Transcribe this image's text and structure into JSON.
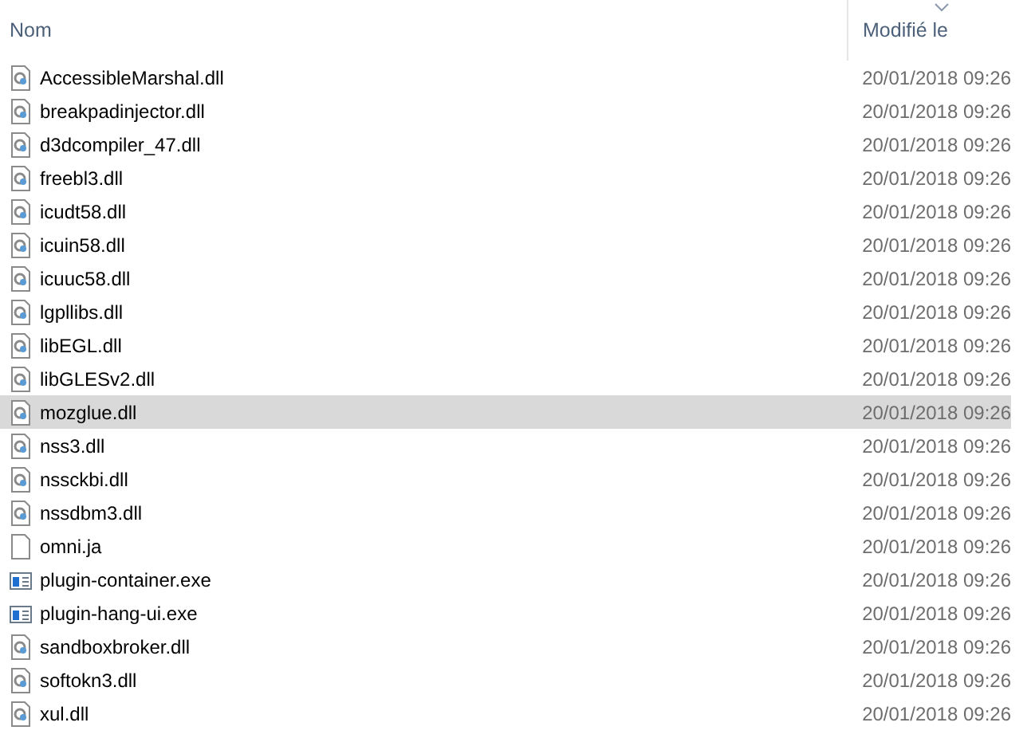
{
  "columns": [
    {
      "label": "Nom",
      "sorted": false
    },
    {
      "label": "Modifié le",
      "sorted": true
    }
  ],
  "files": [
    {
      "name": "AccessibleMarshal.dll",
      "modified": "20/01/2018 09:26",
      "kind": "dll",
      "selected": false
    },
    {
      "name": "breakpadinjector.dll",
      "modified": "20/01/2018 09:26",
      "kind": "dll",
      "selected": false
    },
    {
      "name": "d3dcompiler_47.dll",
      "modified": "20/01/2018 09:26",
      "kind": "dll",
      "selected": false
    },
    {
      "name": "freebl3.dll",
      "modified": "20/01/2018 09:26",
      "kind": "dll",
      "selected": false
    },
    {
      "name": "icudt58.dll",
      "modified": "20/01/2018 09:26",
      "kind": "dll",
      "selected": false
    },
    {
      "name": "icuin58.dll",
      "modified": "20/01/2018 09:26",
      "kind": "dll",
      "selected": false
    },
    {
      "name": "icuuc58.dll",
      "modified": "20/01/2018 09:26",
      "kind": "dll",
      "selected": false
    },
    {
      "name": "lgpllibs.dll",
      "modified": "20/01/2018 09:26",
      "kind": "dll",
      "selected": false
    },
    {
      "name": "libEGL.dll",
      "modified": "20/01/2018 09:26",
      "kind": "dll",
      "selected": false
    },
    {
      "name": "libGLESv2.dll",
      "modified": "20/01/2018 09:26",
      "kind": "dll",
      "selected": false
    },
    {
      "name": "mozglue.dll",
      "modified": "20/01/2018 09:26",
      "kind": "dll",
      "selected": true
    },
    {
      "name": "nss3.dll",
      "modified": "20/01/2018 09:26",
      "kind": "dll",
      "selected": false
    },
    {
      "name": "nssckbi.dll",
      "modified": "20/01/2018 09:26",
      "kind": "dll",
      "selected": false
    },
    {
      "name": "nssdbm3.dll",
      "modified": "20/01/2018 09:26",
      "kind": "dll",
      "selected": false
    },
    {
      "name": "omni.ja",
      "modified": "20/01/2018 09:26",
      "kind": "file",
      "selected": false
    },
    {
      "name": "plugin-container.exe",
      "modified": "20/01/2018 09:26",
      "kind": "exe",
      "selected": false
    },
    {
      "name": "plugin-hang-ui.exe",
      "modified": "20/01/2018 09:26",
      "kind": "exe",
      "selected": false
    },
    {
      "name": "sandboxbroker.dll",
      "modified": "20/01/2018 09:26",
      "kind": "dll",
      "selected": false
    },
    {
      "name": "softokn3.dll",
      "modified": "20/01/2018 09:26",
      "kind": "dll",
      "selected": false
    },
    {
      "name": "xul.dll",
      "modified": "20/01/2018 09:26",
      "kind": "dll",
      "selected": false
    }
  ]
}
